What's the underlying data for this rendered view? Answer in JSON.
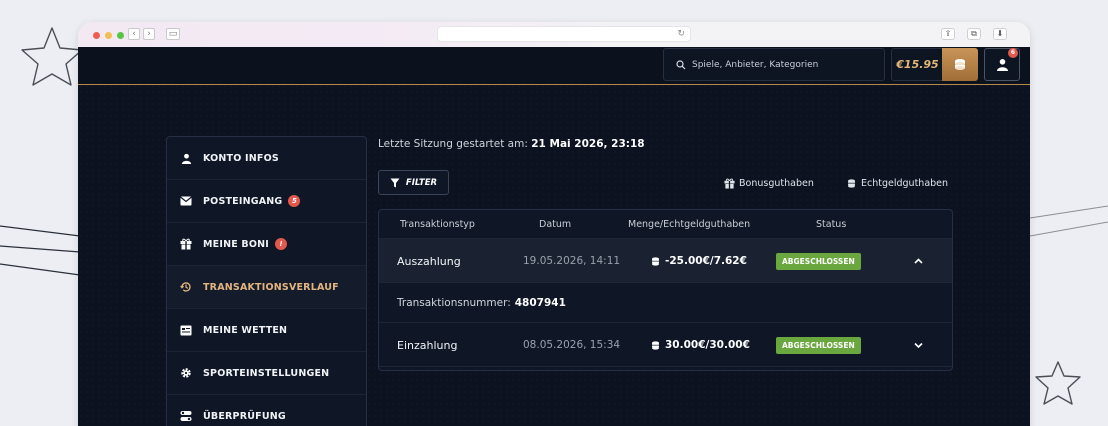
{
  "topbar": {
    "search_placeholder": "Spiele, Anbieter, Kategorien",
    "balance": "€15.95",
    "profile_badge": "6"
  },
  "sidebar": {
    "items": [
      {
        "label": "KONTO INFOS",
        "icon": "user-icon"
      },
      {
        "label": "POSTEINGANG",
        "icon": "envelope-icon",
        "badge": "5"
      },
      {
        "label": "MEINE BONI",
        "icon": "gift-icon",
        "badge": "!"
      },
      {
        "label": "TRANSAKTIONSVERLAUF",
        "icon": "history-icon",
        "active": true
      },
      {
        "label": "MEINE WETTEN",
        "icon": "ticket-icon"
      },
      {
        "label": "SPORTEINSTELLUNGEN",
        "icon": "gear-icon"
      },
      {
        "label": "ÜBERPRÜFUNG",
        "icon": "toggle-icon"
      }
    ]
  },
  "session": {
    "label": "Letzte Sitzung gestartet am:",
    "value": "21 Mai 2026, 23:18"
  },
  "filter": {
    "label": "FILTER"
  },
  "legend": {
    "bonus": "Bonusguthaben",
    "real": "Echtgeldguthaben"
  },
  "table": {
    "headers": [
      "Transaktionstyp",
      "Datum",
      "Menge/Echtgeldguthaben",
      "Status"
    ],
    "rows": [
      {
        "type": "Auszahlung",
        "date": "19.05.2026, 14:11",
        "amount": "-25.00€/7.62€",
        "status": "ABGESCHLOSSEN",
        "expanded": true
      },
      {
        "type": "Einzahlung",
        "date": "08.05.2026, 15:34",
        "amount": "30.00€/30.00€",
        "status": "ABGESCHLOSSEN",
        "expanded": false
      }
    ],
    "detail": {
      "label": "Transaktionsnummer:",
      "value": "4807941"
    }
  },
  "colors": {
    "accent": "#e3b480",
    "status_green": "#6aa83f",
    "badge_red": "#e2584a",
    "background": "#0c1220"
  }
}
